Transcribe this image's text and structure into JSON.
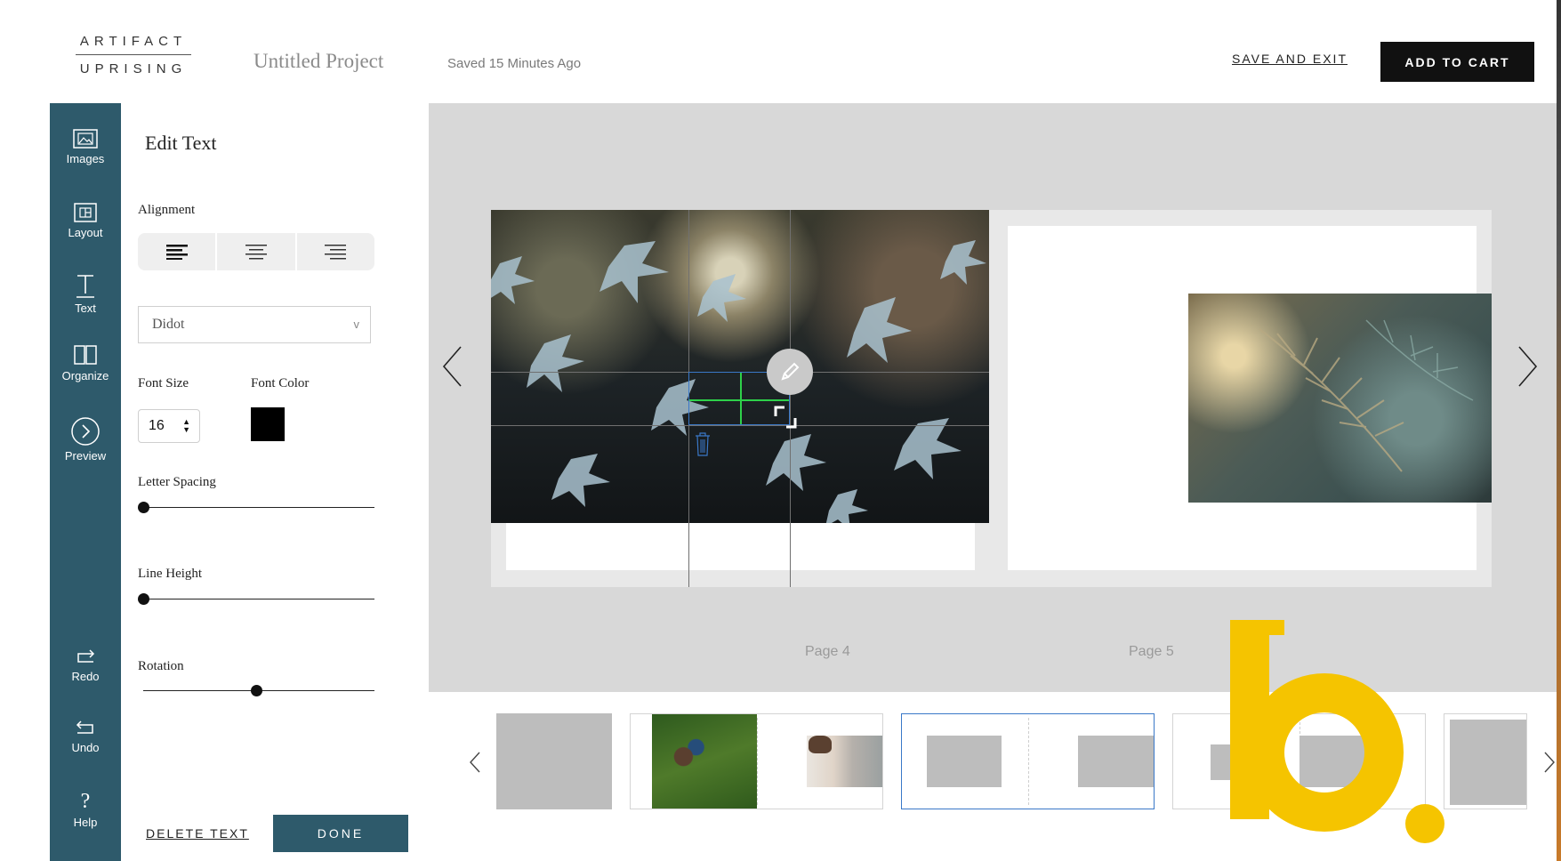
{
  "header": {
    "logo_top": "ARTIFACT",
    "logo_bottom": "UPRISING",
    "project_title": "Untitled Project",
    "saved_status": "Saved 15 Minutes Ago",
    "save_exit_label": "SAVE AND EXIT",
    "add_to_cart_label": "ADD TO CART"
  },
  "rail": {
    "items": [
      {
        "label": "Images",
        "icon": "image-icon"
      },
      {
        "label": "Layout",
        "icon": "layout-icon"
      },
      {
        "label": "Text",
        "icon": "text-icon"
      },
      {
        "label": "Organize",
        "icon": "book-icon"
      },
      {
        "label": "Preview",
        "icon": "chevron-circle-icon"
      }
    ],
    "bottom_items": [
      {
        "label": "Redo",
        "icon": "redo-icon"
      },
      {
        "label": "Undo",
        "icon": "undo-icon"
      },
      {
        "label": "Help",
        "icon": "help-icon"
      }
    ],
    "active": "Text",
    "color": "#2e5a6b"
  },
  "panel": {
    "title": "Edit Text",
    "alignment_label": "Alignment",
    "font_family": "Didot",
    "font_size_label": "Font Size",
    "font_size": "16",
    "font_color_label": "Font Color",
    "font_color": "#000000",
    "letter_spacing_label": "Letter Spacing",
    "letter_spacing": 0,
    "line_height_label": "Line Height",
    "line_height": 0,
    "rotation_label": "Rotation",
    "rotation": 0.5,
    "delete_text_label": "DELETE TEXT",
    "done_label": "DONE"
  },
  "canvas": {
    "pages": [
      {
        "label": "Page 4"
      },
      {
        "label": "Page 5"
      }
    ]
  },
  "filmstrip": {
    "selected_index": 2
  },
  "colors": {
    "accent": "#2e5a6b",
    "selection_blue": "#3a78c8",
    "snap_green": "#2ed14a",
    "watermark_yellow": "#f5c400"
  }
}
